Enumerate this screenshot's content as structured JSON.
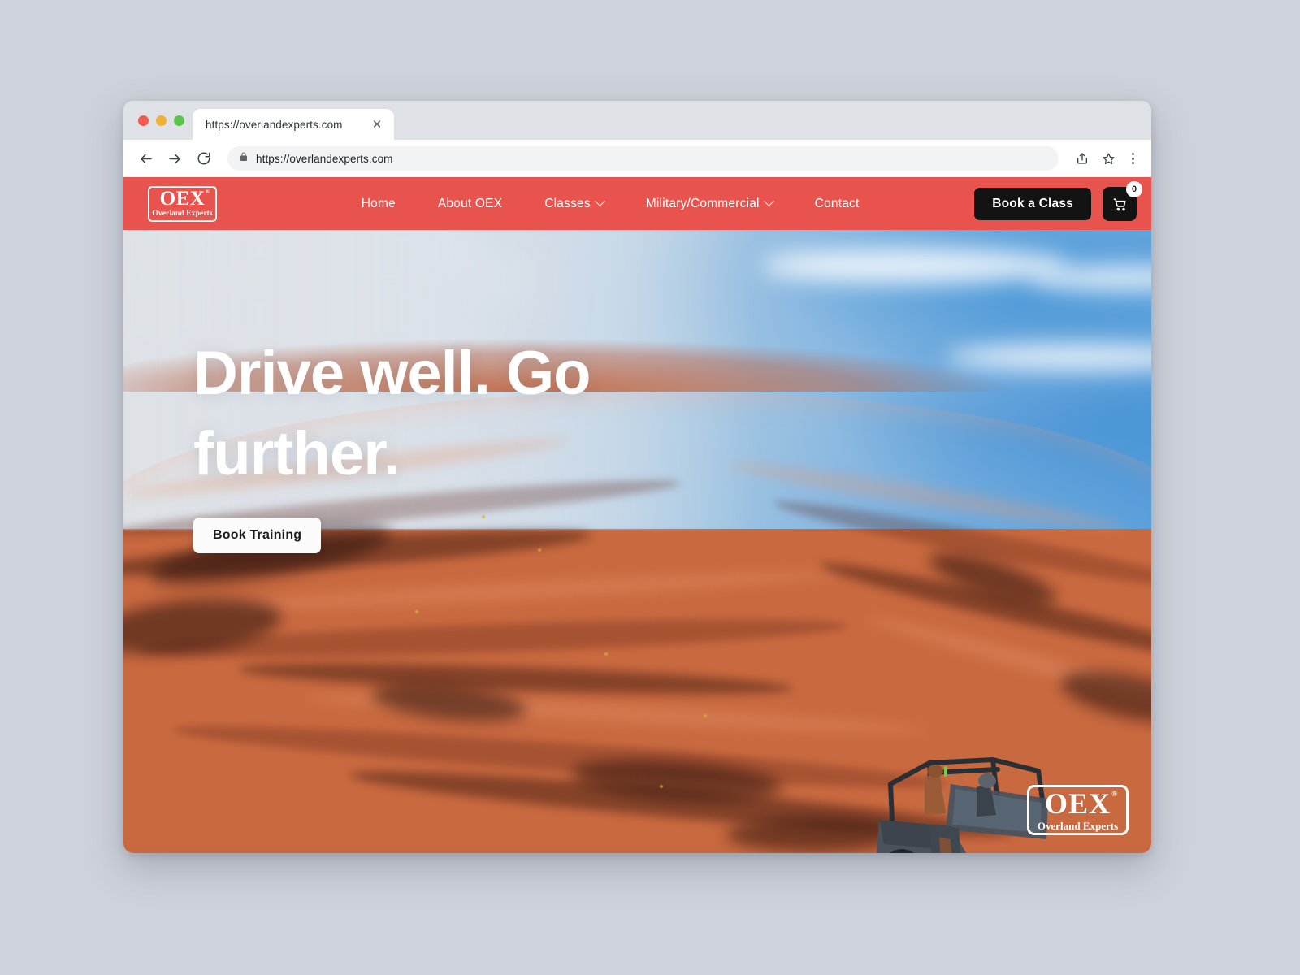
{
  "browser": {
    "tab_title": "https://overlandexperts.com",
    "tab_close_icon": "close-icon",
    "back_icon": "back-arrow-icon",
    "forward_icon": "forward-arrow-icon",
    "reload_icon": "reload-icon",
    "lock_icon": "lock-icon",
    "url": "https://overlandexperts.com",
    "share_icon": "share-icon",
    "bookmark_icon": "star-icon",
    "menu_icon": "kebab-menu-icon",
    "traffic_lights": [
      "close",
      "minimize",
      "maximize"
    ]
  },
  "site": {
    "nav": {
      "logo": {
        "mark": "OEX",
        "registered": "®",
        "sub": "Overland Experts"
      },
      "items": [
        {
          "label": "Home",
          "has_dropdown": false
        },
        {
          "label": "About OEX",
          "has_dropdown": false
        },
        {
          "label": "Classes",
          "has_dropdown": true
        },
        {
          "label": "Military/Commercial",
          "has_dropdown": true
        },
        {
          "label": "Contact",
          "has_dropdown": false
        }
      ],
      "cta_label": "Book a Class",
      "cart_icon": "shopping-cart-icon",
      "cart_count": "0",
      "accent_color": "#e8534e",
      "cta_color": "#131313"
    },
    "hero": {
      "headline": "Drive well. Go further.",
      "cta_label": "Book Training",
      "watermark": {
        "mark": "OEX",
        "registered": "®",
        "sub": "Overland Experts"
      },
      "image_alt": "Gray off-road vehicle climbing red slickrock under a blue sky"
    }
  }
}
